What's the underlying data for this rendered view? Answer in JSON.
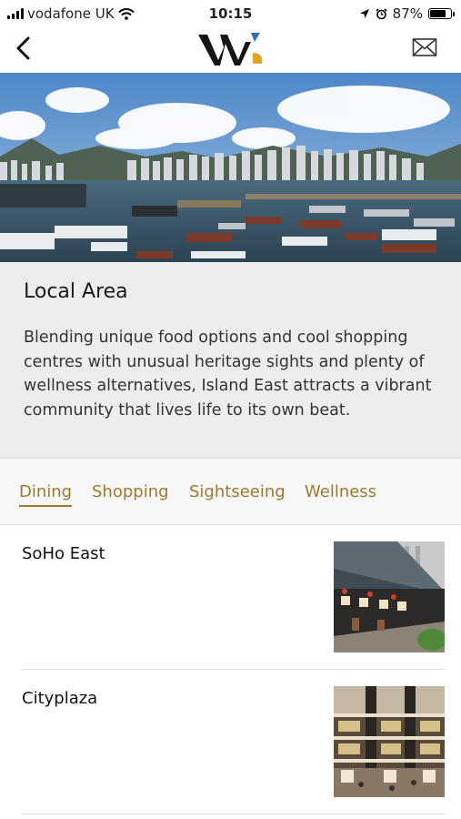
{
  "status_bar": {
    "carrier": "vodafone UK",
    "time": "10:15",
    "battery_percent": "87%",
    "battery_level": 0.87
  },
  "nav": {
    "back_icon": "chevron-left-icon",
    "logo": "brand-logo",
    "mail_icon": "envelope-icon"
  },
  "hero": {
    "image": "harbour-skyline-photo"
  },
  "intro": {
    "title": "Local Area",
    "description": "Blending unique food options and cool shopping centres with unusual heritage sights and plenty of wellness alternatives, Island East attracts a vibrant community that lives life to its own beat."
  },
  "tabs": [
    {
      "label": "Dining",
      "active": true
    },
    {
      "label": "Shopping",
      "active": false
    },
    {
      "label": "Sightseeing",
      "active": false
    },
    {
      "label": "Wellness",
      "active": false
    }
  ],
  "places": [
    {
      "name": "SoHo East",
      "thumbnail": "waterfront-restaurants-photo"
    },
    {
      "name": "Cityplaza",
      "thumbnail": "mall-atrium-photo"
    }
  ],
  "colors": {
    "accent": "#9a7a2e",
    "intro_background": "#ededed",
    "logo_gold": "#e0a526",
    "logo_blue": "#2d6fb7"
  }
}
